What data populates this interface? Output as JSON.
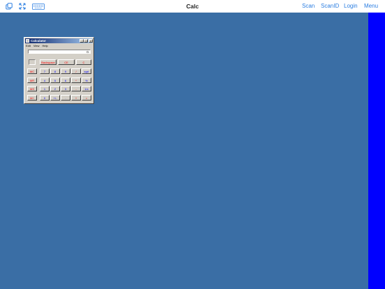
{
  "topbar": {
    "title": "Calc",
    "links": {
      "scan": "Scan",
      "scanid": "ScanID",
      "login": "Login",
      "menu": "Menu"
    }
  },
  "calculator": {
    "window_title": "Calculator",
    "window_buttons": {
      "minimize": "_",
      "maximize": "□",
      "close": "×"
    },
    "menu": {
      "edit": "Edit",
      "view": "View",
      "help": "Help"
    },
    "display_value": "0.",
    "top_keys": {
      "backspace": "Backspace",
      "ce": "CE",
      "c": "C"
    },
    "memory_keys": [
      "MC",
      "MR",
      "MS",
      "M+"
    ],
    "keypad_rows": [
      [
        "7",
        "8",
        "9",
        "/",
        "sqrt"
      ],
      [
        "4",
        "5",
        "6",
        "*",
        "%"
      ],
      [
        "1",
        "2",
        "3",
        "-",
        "1/x"
      ],
      [
        "0",
        "+/-",
        ".",
        "+",
        "="
      ]
    ],
    "colors": {
      "digit": "#0000ff",
      "operator": "#ff0000",
      "titlebar_start": "#0a246a"
    }
  }
}
